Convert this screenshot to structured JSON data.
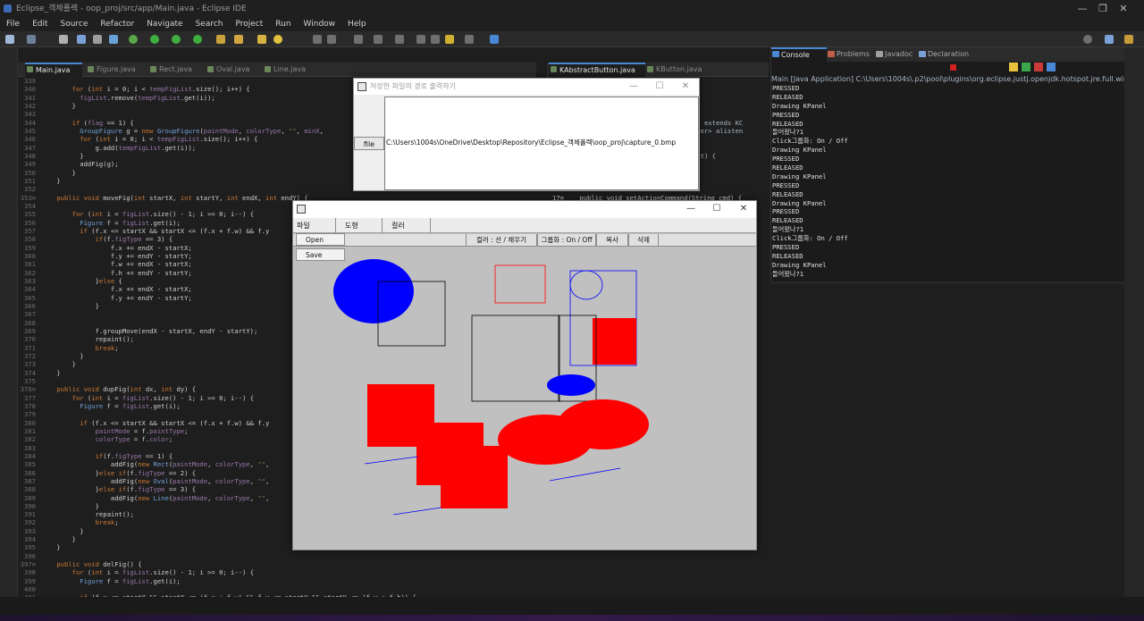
{
  "window": {
    "title": "Eclipse_객체폴렉 - oop_proj/src/app/Main.java - Eclipse IDE",
    "controls": [
      "—",
      "❐",
      "✕"
    ]
  },
  "menu": [
    "File",
    "Edit",
    "Source",
    "Refactor",
    "Navigate",
    "Search",
    "Project",
    "Run",
    "Window",
    "Help"
  ],
  "editor_left": {
    "tabs": [
      {
        "label": "Main.java",
        "active": true
      },
      {
        "label": "Figure.java",
        "active": false
      },
      {
        "label": "Rect.java",
        "active": false
      },
      {
        "label": "Oval.java",
        "active": false
      },
      {
        "label": "Line.java",
        "active": false
      }
    ],
    "lines": [
      {
        "n": "339",
        "code": ""
      },
      {
        "n": "340",
        "code": "        for (int i = 0; i < tempFigList.size(); i++) {"
      },
      {
        "n": "341",
        "code": "          figList.remove(tempFigList.get(i));"
      },
      {
        "n": "342",
        "code": "        }"
      },
      {
        "n": "343",
        "code": ""
      },
      {
        "n": "344",
        "code": "        if (flag == 1) {"
      },
      {
        "n": "345",
        "code": "          GroupFigure g = new GroupFigure(paintMode, colorType, \"\", minX,"
      },
      {
        "n": "346",
        "code": "          for (int i = 0; i < tempFigList.size(); i++) {"
      },
      {
        "n": "347",
        "code": "              g.add(tempFigList.get(i));"
      },
      {
        "n": "348",
        "code": "          }"
      },
      {
        "n": "349",
        "code": "          addFig(g);"
      },
      {
        "n": "350",
        "code": "        }"
      },
      {
        "n": "351",
        "code": "    }"
      },
      {
        "n": "352",
        "code": ""
      },
      {
        "n": "353⊖",
        "code": "    public void moveFig(int startX, int startY, int endX, int endY) {"
      },
      {
        "n": "354",
        "code": ""
      },
      {
        "n": "355",
        "code": "        for (int i = figList.size() - 1; i >= 0; i--) {"
      },
      {
        "n": "356",
        "code": "          Figure f = figList.get(i);"
      },
      {
        "n": "357",
        "code": "          if (f.x <= startX && startX <= (f.x + f.w) && f.y"
      },
      {
        "n": "358",
        "code": "              if(f.figType == 3) {"
      },
      {
        "n": "359",
        "code": "                  f.x += endX - startX;"
      },
      {
        "n": "360",
        "code": "                  f.y += endY - startY;"
      },
      {
        "n": "361",
        "code": "                  f.w += endX - startX;"
      },
      {
        "n": "362",
        "code": "                  f.h += endY - startY;"
      },
      {
        "n": "363",
        "code": "              }else {"
      },
      {
        "n": "364",
        "code": "                  f.x += endX - startX;"
      },
      {
        "n": "365",
        "code": "                  f.y += endY - startY;"
      },
      {
        "n": "366",
        "code": "              }"
      },
      {
        "n": "367",
        "code": ""
      },
      {
        "n": "368",
        "code": ""
      },
      {
        "n": "369",
        "code": "              f.groupMove(endX - startX, endY - startY);"
      },
      {
        "n": "370",
        "code": "              repaint();"
      },
      {
        "n": "371",
        "code": "              break;"
      },
      {
        "n": "372",
        "code": "          }"
      },
      {
        "n": "373",
        "code": "        }"
      },
      {
        "n": "374",
        "code": "    }"
      },
      {
        "n": "375",
        "code": ""
      },
      {
        "n": "376⊖",
        "code": "    public void dupFig(int dx, int dy) {"
      },
      {
        "n": "377",
        "code": "        for (int i = figList.size() - 1; i >= 0; i--) {"
      },
      {
        "n": "378",
        "code": "          Figure f = figList.get(i);"
      },
      {
        "n": "379",
        "code": ""
      },
      {
        "n": "380",
        "code": "          if (f.x <= startX && startX <= (f.x + f.w) && f.y"
      },
      {
        "n": "381",
        "code": "              paintMode = f.paintType;"
      },
      {
        "n": "382",
        "code": "              colorType = f.color;"
      },
      {
        "n": "383",
        "code": ""
      },
      {
        "n": "384",
        "code": "              if(f.figType == 1) {"
      },
      {
        "n": "385",
        "code": "                  addFig(new Rect(paintMode, colorType, \"\","
      },
      {
        "n": "386",
        "code": "              }else if(f.figType == 2) {"
      },
      {
        "n": "387",
        "code": "                  addFig(new Oval(paintMode, colorType, \"\","
      },
      {
        "n": "388",
        "code": "              }else if(f.figType == 3) {"
      },
      {
        "n": "389",
        "code": "                  addFig(new Line(paintMode, colorType, \"\","
      },
      {
        "n": "390",
        "code": "              }"
      },
      {
        "n": "391",
        "code": "              repaint();"
      },
      {
        "n": "392",
        "code": "              break;"
      },
      {
        "n": "393",
        "code": "          }"
      },
      {
        "n": "394",
        "code": "        }"
      },
      {
        "n": "395",
        "code": "    }"
      },
      {
        "n": "396",
        "code": ""
      },
      {
        "n": "397⊖",
        "code": "    public void delFig() {"
      },
      {
        "n": "398",
        "code": "        for (int i = figList.size() - 1; i >= 0; i--) {"
      },
      {
        "n": "399",
        "code": "          Figure f = figList.get(i);"
      },
      {
        "n": "400",
        "code": ""
      },
      {
        "n": "401",
        "code": "          if (f.x <= startX && startX <= (f.x + f.w) && f.y <= startY && startY <= (f.y + f.h)) {"
      }
    ]
  },
  "editor_right": {
    "tabs": [
      {
        "label": "KAbstractButton.java",
        "active": true
      },
      {
        "label": "KButton.java",
        "active": false
      }
    ],
    "fragments": [
      {
        "text": "nt;",
        "row": 2
      },
      {
        "text": "utton extends KC",
        "row": 5
      },
      {
        "text": "istener> alisten",
        "row": 6
      },
      {
        "text": "g text) {",
        "row": 9
      },
      {
        "text": "17⊖    public void setActionCommand(String cmd) {",
        "row": 14
      },
      {
        "text": "en",
        "row": 18
      },
      {
        "text": "erg",
        "row": 24
      },
      {
        "text": ".toArray(new KAc",
        "row": 25
      },
      {
        "text": "e) {",
        "row": 29
      },
      {
        "text": "KED) {",
        "row": 31
      },
      {
        "text": ".text);",
        "row": 32
      },
      {
        "text": ") {",
        "row": 33
      },
      {
        "text": "vent(this, e.get",
        "row": 34
      }
    ]
  },
  "console": {
    "tabs": [
      "Console",
      "Problems",
      "Javadoc",
      "Declaration"
    ],
    "process": "Main [Java Application] C:\\Users\\1004s\\.p2\\pool\\plugins\\org.eclipse.justj.openjdk.hotspot.jre.full.win32.x8",
    "lines": [
      "PRESSED",
      "RELEASED",
      "Drawing KPanel",
      "PRESSED",
      "RELEASED",
      "들어왔나?1",
      "Click그룹화: On / Off",
      "Drawing KPanel",
      "PRESSED",
      "RELEASED",
      "Drawing KPanel",
      "PRESSED",
      "RELEASED",
      "Drawing KPanel",
      "PRESSED",
      "RELEASED",
      "들어왔나?1",
      "Click그룹화: On / Off",
      "PRESSED",
      "RELEASED",
      "Drawing KPanel",
      "들어왔나?1"
    ]
  },
  "dialog": {
    "title": "저장한 파일의 경로 출력하기",
    "button": "file",
    "path": "C:\\Users\\1004s\\OneDrive\\Desktop\\Repository\\Eclipse_객체폴렉\\oop_proj\\capture_0.bmp",
    "controls": [
      "—",
      "☐",
      "✕"
    ]
  },
  "app": {
    "controls": [
      "—",
      "☐",
      "✕"
    ],
    "menus": [
      "파일",
      "도형",
      "컬러"
    ],
    "file_menu_items": [
      "Open",
      "Save"
    ],
    "status": [
      "컬러 : 선 / 채우기",
      "그룹화 : On / Off",
      "복사",
      "삭제"
    ],
    "shapes": {
      "colors": {
        "blue": "#0000ff",
        "red": "#ff0000",
        "black": "#000000"
      }
    }
  }
}
